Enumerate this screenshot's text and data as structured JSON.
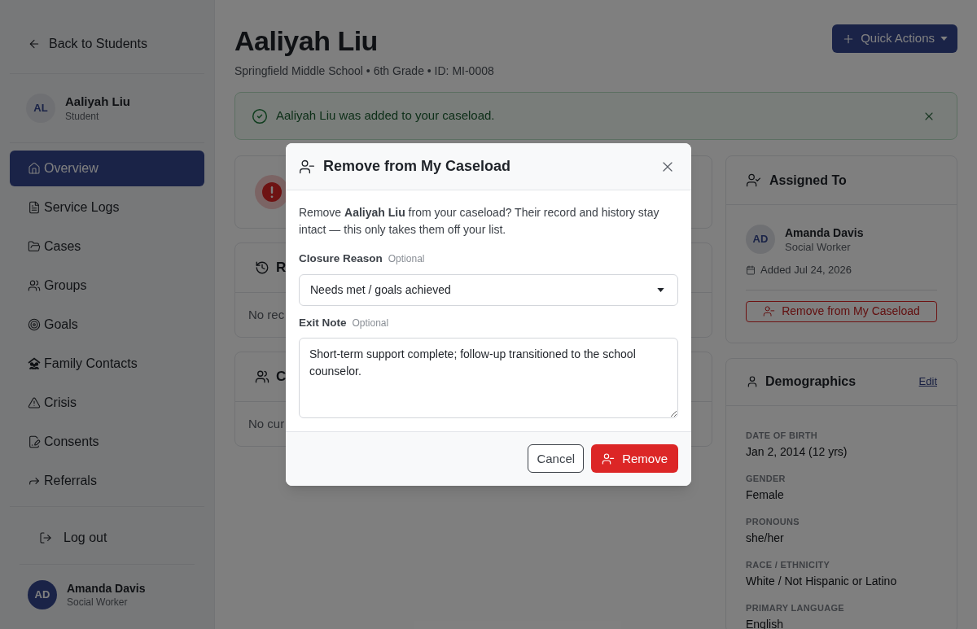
{
  "sidebar": {
    "back_link": "Back to Students",
    "student": {
      "initials": "AL",
      "name": "Aaliyah Liu",
      "role": "Student"
    },
    "nav_items": [
      {
        "label": "Overview",
        "selected": true
      },
      {
        "label": "Service Logs",
        "selected": false
      },
      {
        "label": "Cases",
        "selected": false
      },
      {
        "label": "Groups",
        "selected": false
      },
      {
        "label": "Goals",
        "selected": false
      },
      {
        "label": "Family Contacts",
        "selected": false
      },
      {
        "label": "Crisis",
        "selected": false
      },
      {
        "label": "Consents",
        "selected": false
      },
      {
        "label": "Referrals",
        "selected": false
      }
    ],
    "logout": "Log out",
    "user": {
      "initials": "AD",
      "name": "Amanda Davis",
      "role": "Social Worker"
    }
  },
  "header": {
    "title": "Aaliyah Liu",
    "subtitle": "Springfield Middle School • 6th Grade • ID: MI-0008",
    "quick_actions": "Quick Actions"
  },
  "alert": {
    "message": "Aaliyah Liu was added to your caseload."
  },
  "left_cards": [
    {
      "kind": "notice"
    },
    {
      "kind": "section",
      "title": "R",
      "body": "No rec"
    },
    {
      "kind": "section",
      "title": "C",
      "body": "No cur"
    }
  ],
  "assigned_card": {
    "title": "Assigned To",
    "assignee": {
      "initials": "AD",
      "name": "Amanda Davis",
      "role": "Social Worker"
    },
    "added": "Added Jul 24, 2026",
    "remove_button": "Remove from My Caseload"
  },
  "demographics_card": {
    "title": "Demographics",
    "edit_link": "Edit",
    "fields": [
      {
        "label": "DATE OF BIRTH",
        "value": "Jan 2, 2014 (12 yrs)"
      },
      {
        "label": "GENDER",
        "value": "Female"
      },
      {
        "label": "PRONOUNS",
        "value": "she/her"
      },
      {
        "label": "RACE / ETHNICITY",
        "value": "White / Not Hispanic or Latino"
      },
      {
        "label": "PRIMARY LANGUAGE",
        "value": "English"
      }
    ]
  },
  "modal": {
    "title": "Remove from My Caseload",
    "message": "Remove **Aaliyah Liu** from your caseload? Their record and history stay intact — this only takes them off your list.",
    "closure_reason": {
      "label": "Closure Reason",
      "hint": "Optional",
      "value": "Needs met / goals achieved"
    },
    "exit_note": {
      "label": "Exit Note",
      "hint": "Optional",
      "value": "Short-term support complete; follow-up transitioned to the school counselor."
    },
    "buttons": [
      {
        "label": "Cancel",
        "kind": "secondary"
      },
      {
        "label": "Remove",
        "kind": "danger"
      }
    ]
  }
}
